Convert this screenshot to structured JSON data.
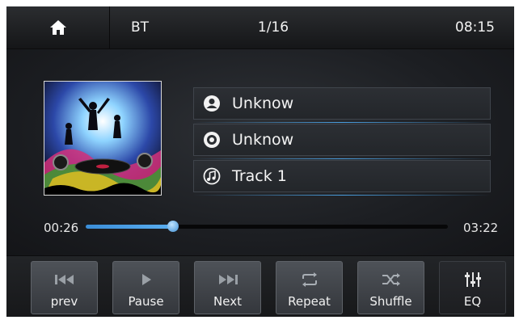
{
  "topbar": {
    "home_icon": "home-icon",
    "source": "BT",
    "track_index": "1/16",
    "clock": "08:15"
  },
  "now_playing": {
    "album_art": "album-art-concert",
    "rows": [
      {
        "icon": "artist-icon",
        "text": "Unknow"
      },
      {
        "icon": "album-disc-icon",
        "text": "Unknow"
      },
      {
        "icon": "music-note-icon",
        "text": "Track 1"
      }
    ]
  },
  "progress": {
    "elapsed": "00:26",
    "total": "03:22",
    "fraction": 0.24
  },
  "controls": [
    {
      "icon": "previous-track-icon",
      "label": "prev"
    },
    {
      "icon": "play-icon",
      "label": "Pause"
    },
    {
      "icon": "next-track-icon",
      "label": "Next"
    },
    {
      "icon": "repeat-icon",
      "label": "Repeat"
    },
    {
      "icon": "shuffle-icon",
      "label": "Shuffle"
    },
    {
      "icon": "equalizer-icon",
      "label": "EQ"
    }
  ],
  "colors": {
    "accent": "#4a9fe0",
    "background": "#1a1c20",
    "button": "#45484d"
  }
}
